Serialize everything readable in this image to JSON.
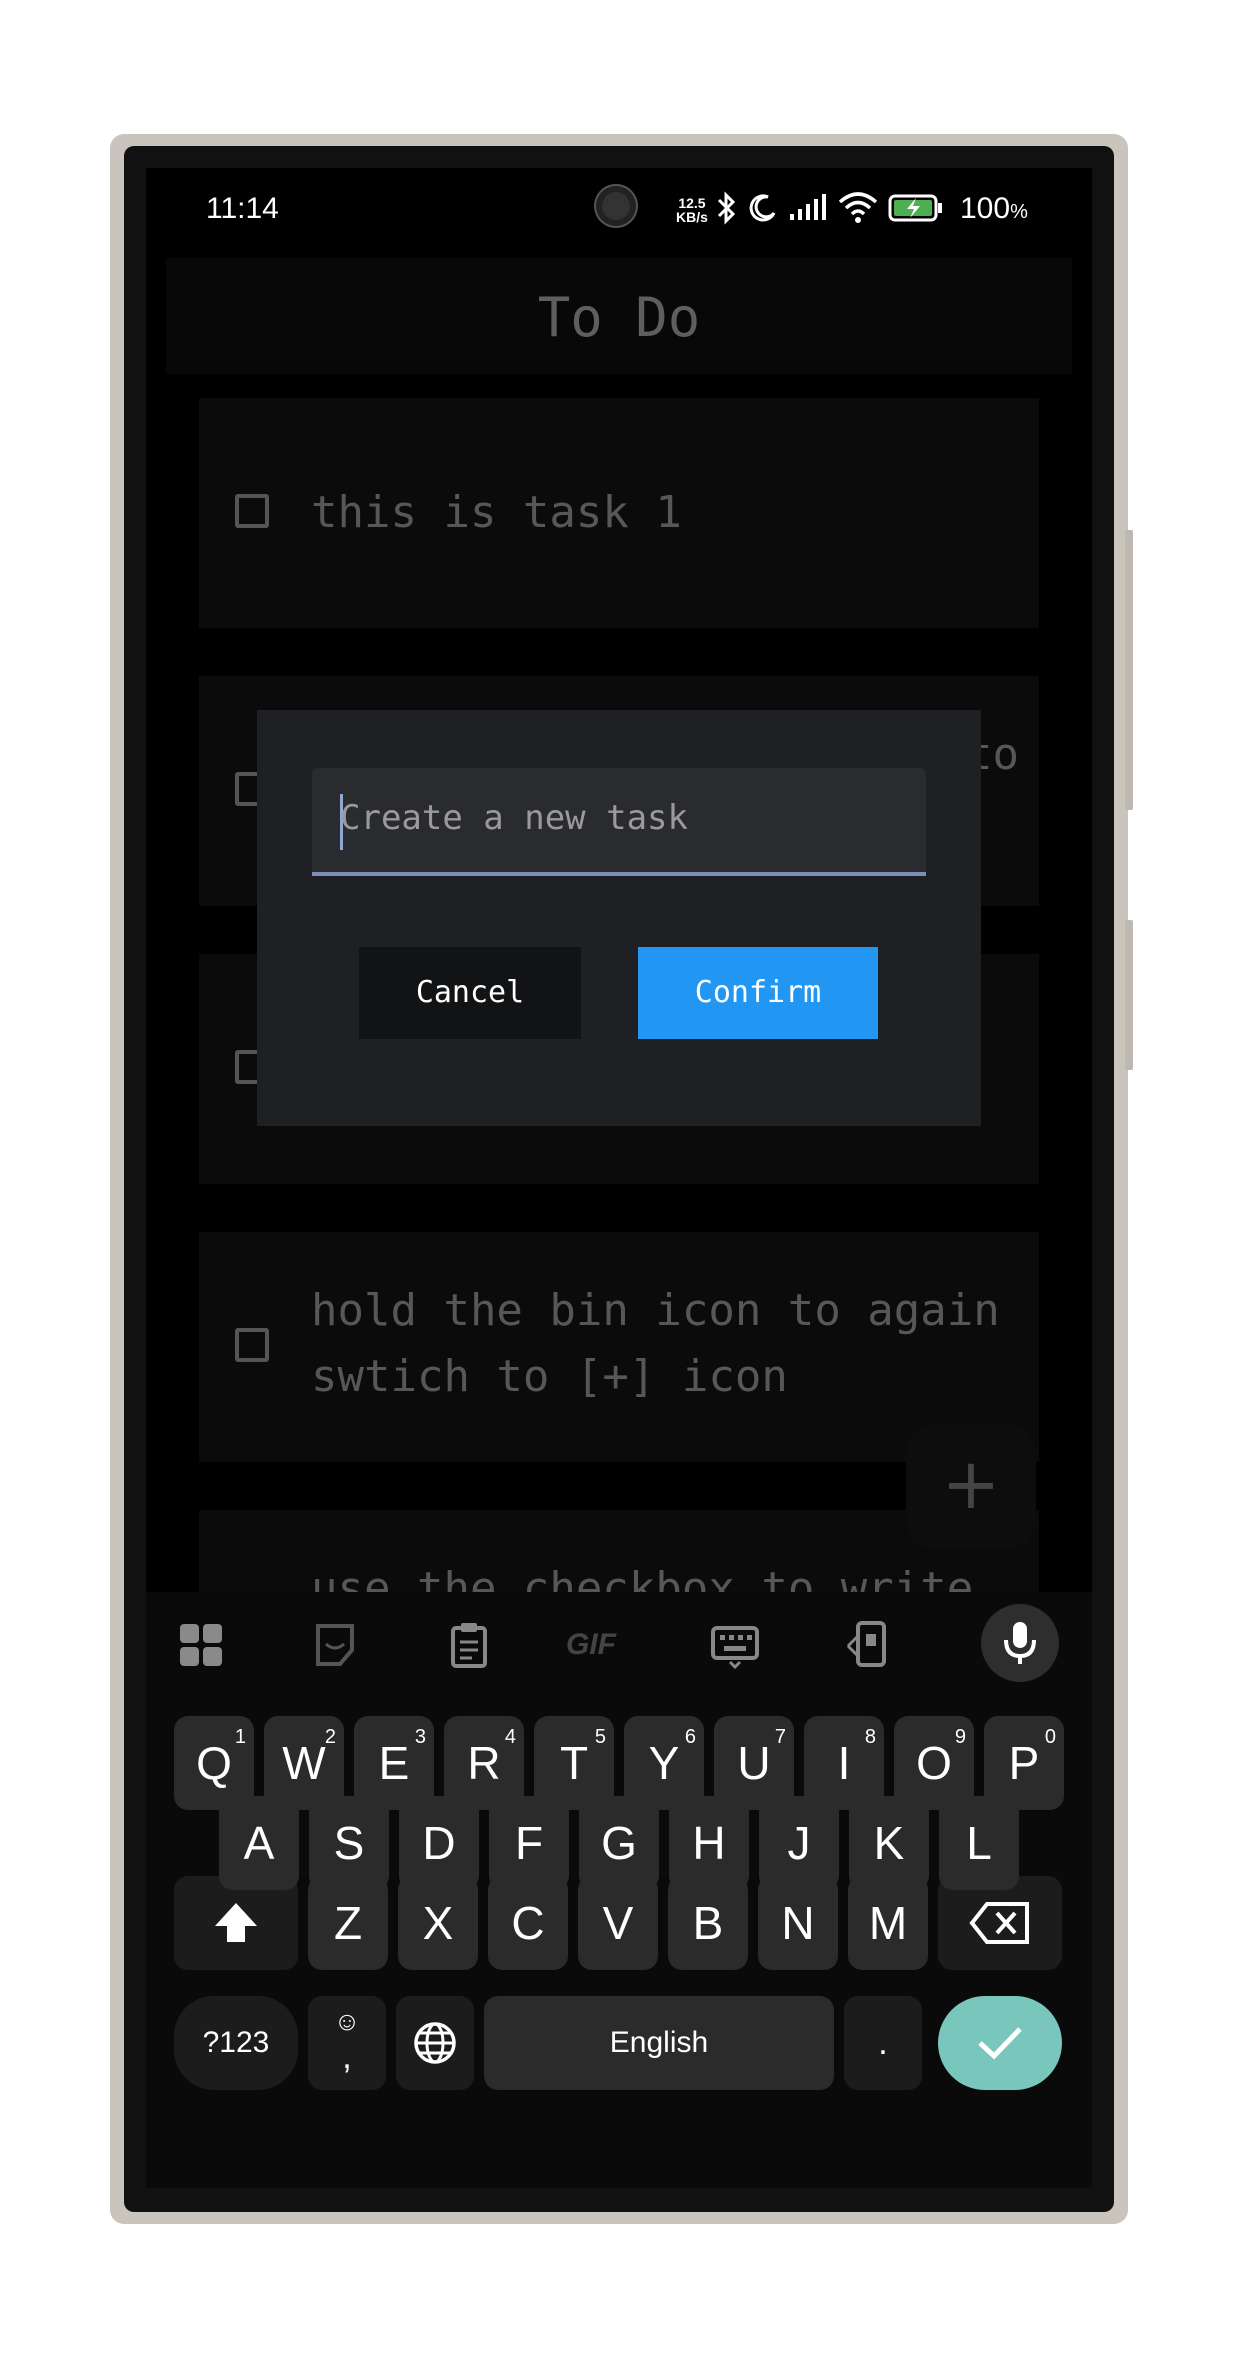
{
  "status_bar": {
    "time": "11:14",
    "net_speed_value": "12.5",
    "net_speed_unit": "KB/s",
    "battery_percent": "100",
    "battery_unit": "%"
  },
  "app": {
    "title": "To Do"
  },
  "tasks": [
    {
      "text": "this is task 1"
    },
    {
      "text": "to"
    },
    {
      "text": ""
    },
    {
      "text": "hold the bin icon to again\nswtich to [+] icon"
    },
    {
      "text": "use the checkbox to write"
    }
  ],
  "fab_label": "+",
  "dialog": {
    "placeholder": "Create a new task",
    "cancel_label": "Cancel",
    "confirm_label": "Confirm"
  },
  "keyboard": {
    "toolbar_icons": [
      "apps-grid-icon",
      "sticker-icon",
      "clipboard-icon",
      "gif-icon",
      "keyboard-icon",
      "phone-translate-icon",
      "microphone-icon"
    ],
    "gif_label": "GIF",
    "row1": [
      "Q",
      "W",
      "E",
      "R",
      "T",
      "Y",
      "U",
      "I",
      "O",
      "P"
    ],
    "row1_hints": [
      "1",
      "2",
      "3",
      "4",
      "5",
      "6",
      "7",
      "8",
      "9",
      "0"
    ],
    "row2": [
      "A",
      "S",
      "D",
      "F",
      "G",
      "H",
      "J",
      "K",
      "L"
    ],
    "row3": [
      "Z",
      "X",
      "C",
      "V",
      "B",
      "N",
      "M"
    ],
    "symbols_label": "?123",
    "comma_label": ",",
    "space_label": "English",
    "period_label": "."
  }
}
